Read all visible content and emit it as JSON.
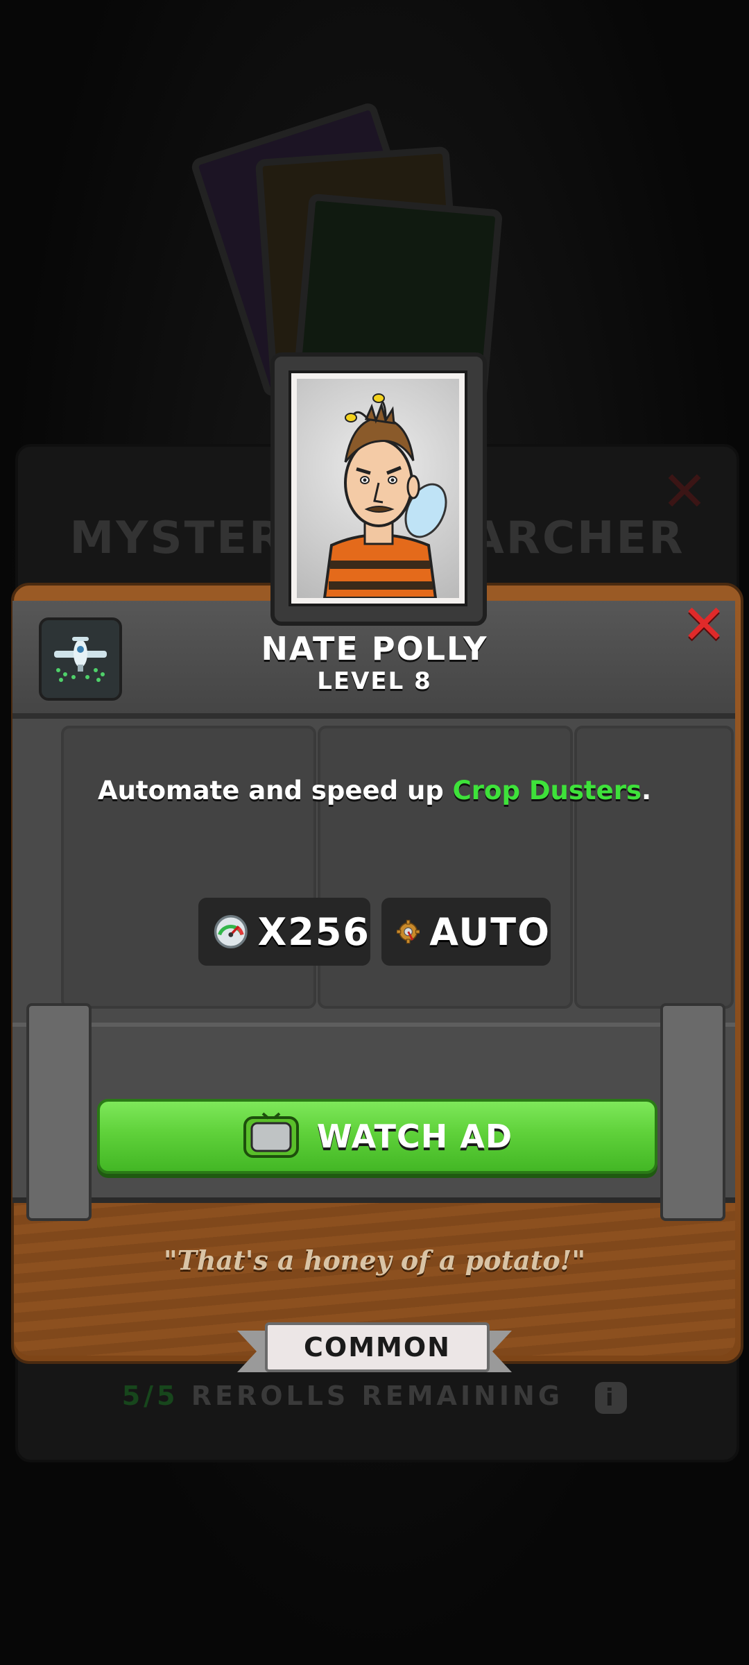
{
  "background": {
    "panel_title": "MYSTERY RESEARCHER",
    "rerolls": {
      "count": "5/5",
      "label": "REROLLS REMAINING",
      "info_icon": "info-icon"
    }
  },
  "researcher": {
    "name": "NATE POLLY",
    "level": "LEVEL 8",
    "icon": "crop-duster-plane-icon",
    "description_prefix": "Automate and speed up ",
    "description_highlight": "Crop Dusters",
    "description_suffix": ".",
    "stats": [
      {
        "icon": "speedometer-icon",
        "value": "X256"
      },
      {
        "icon": "gear-hand-icon",
        "value": "AUTO"
      }
    ],
    "quote": "\"That's a honey of a potato!\"",
    "rarity": "COMMON"
  },
  "actions": {
    "watch_ad_label": "WATCH AD",
    "watch_ad_icon": "tv-icon",
    "close_icon": "close-icon"
  },
  "colors": {
    "highlight": "#3ee23a",
    "button_green": "#5fd13a",
    "close_red": "#e02a2a",
    "wood": "#8c501f"
  }
}
